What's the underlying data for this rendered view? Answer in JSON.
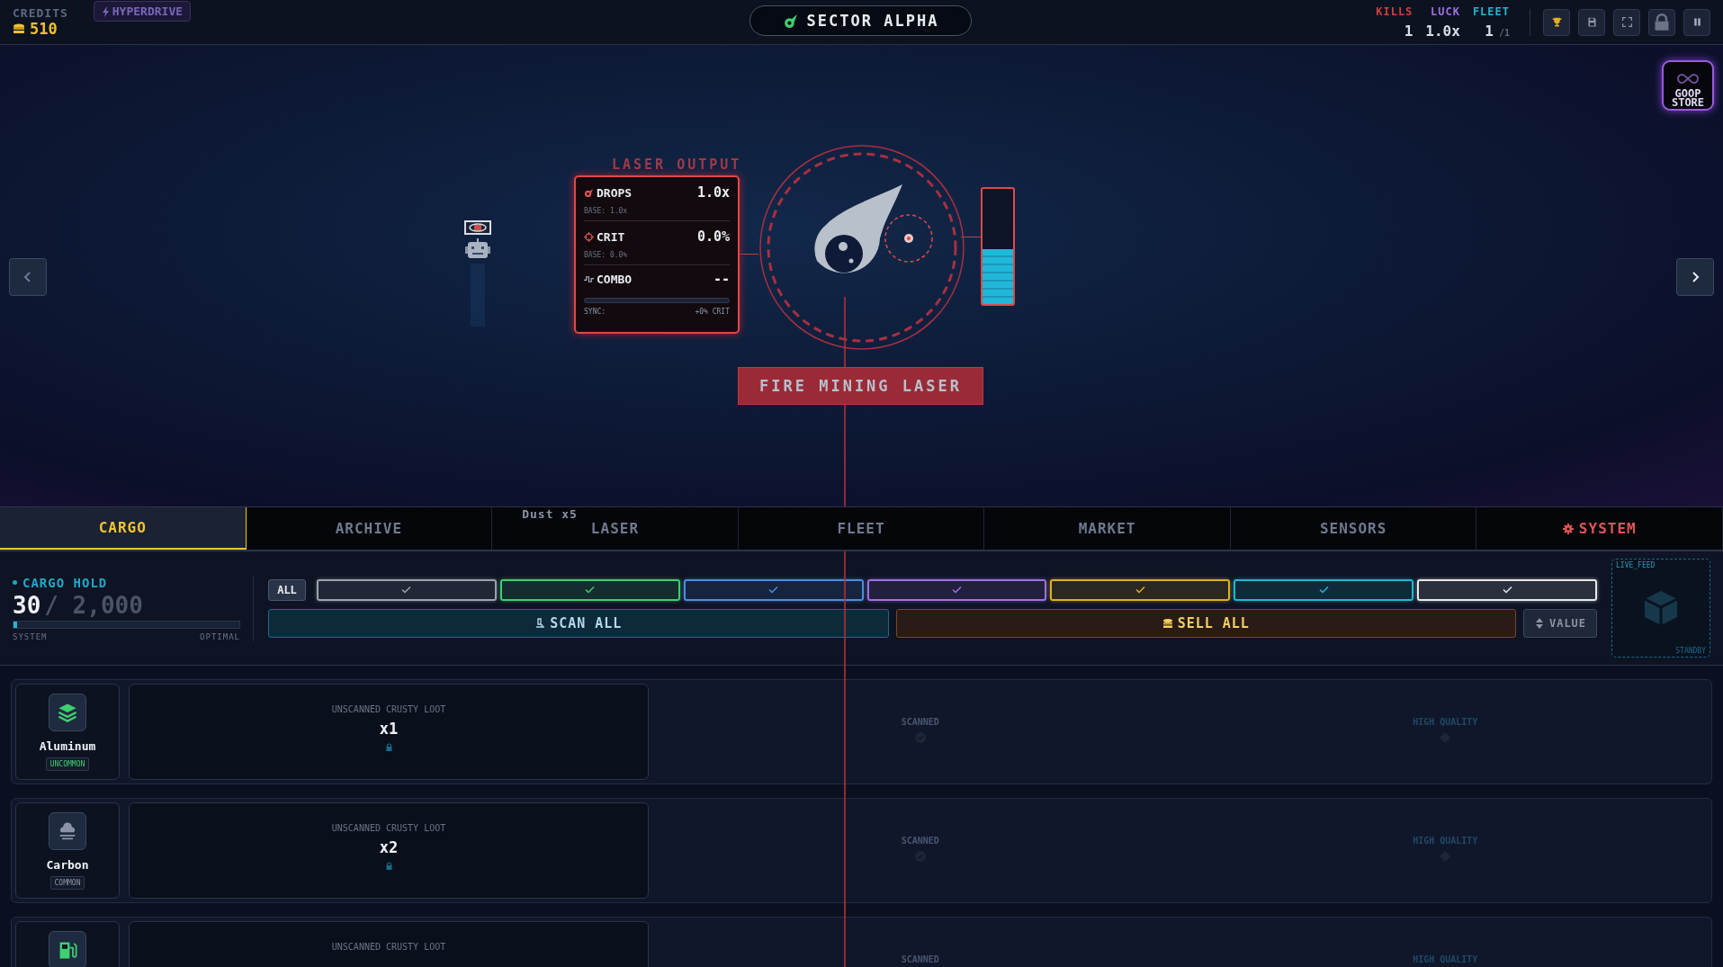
{
  "top_bar": {
    "credits_label": "CREDITS",
    "credits": "510",
    "hyperdrive": "HYPERDRIVE",
    "sector": "SECTOR ALPHA",
    "stats": [
      {
        "label": "KILLS",
        "value": "1",
        "color": "#d04040"
      },
      {
        "label": "LUCK",
        "value": "1.0x",
        "color": "#a070e0"
      },
      {
        "label": "FLEET",
        "value": "1",
        "max": "/1",
        "color": "#20b8d0"
      }
    ],
    "tools": [
      {
        "kind": "trophy"
      },
      {
        "kind": "save"
      },
      {
        "kind": "fullscreen"
      },
      {
        "kind": "lock"
      },
      {
        "kind": "pause"
      }
    ]
  },
  "goop_store": {
    "label": "GOOP STORE"
  },
  "laser_output": {
    "title": "LASER OUTPUT",
    "stats": [
      {
        "kind": "drops",
        "label": "DROPS",
        "value": "1.0x",
        "base": "BASE: 1.0x"
      },
      {
        "kind": "crit",
        "label": "CRIT",
        "value": "0.0%",
        "base": "BASE: 0.0%"
      }
    ],
    "combo": {
      "label": "COMBO",
      "value": "--",
      "sync_label": "SYNC:",
      "sync_value": "+0% CRIT"
    }
  },
  "charge": {
    "level": 0.48
  },
  "fire_button": "FIRE MINING LASER",
  "tabs": [
    {
      "label": "CARGO",
      "selected": true,
      "kind": "normal"
    },
    {
      "label": "ARCHIVE",
      "selected": false,
      "kind": "normal"
    },
    {
      "label": "LASER",
      "selected": false,
      "kind": "normal",
      "badge": "Dust x5"
    },
    {
      "label": "FLEET",
      "selected": false,
      "kind": "normal"
    },
    {
      "label": "MARKET",
      "selected": false,
      "kind": "normal"
    },
    {
      "label": "SENSORS",
      "selected": false,
      "kind": "normal"
    },
    {
      "label": "SYSTEM",
      "selected": false,
      "kind": "system"
    }
  ],
  "cargo_hold": {
    "title": "CARGO HOLD",
    "count": "30",
    "capacity": "/ 2,000",
    "level": 0.015,
    "left_label": "SYSTEM",
    "right_label": "OPTIMAL"
  },
  "filters": {
    "all": "ALL",
    "chips": [
      {
        "color": "#9aa3b0",
        "checked": true
      },
      {
        "color": "#3fcf6f",
        "checked": true
      },
      {
        "color": "#4a8fe0",
        "checked": true
      },
      {
        "color": "#a070e0",
        "checked": true
      },
      {
        "color": "#e0b020",
        "checked": true
      },
      {
        "color": "#20b8d0",
        "checked": true
      },
      {
        "color": "#e8e8e8",
        "checked": true
      }
    ]
  },
  "actions": {
    "scan": "SCAN ALL",
    "sell": "SELL ALL",
    "sort": "VALUE"
  },
  "live_feed": {
    "title": "LIVE_FEED",
    "status": "STANDBY"
  },
  "items": [
    {
      "kind": "layers",
      "name": "Aluminum",
      "rarity": "UNCOMMON",
      "color": "#3fcf6f",
      "loot_label": "UNSCANNED CRUSTY LOOT",
      "count": "x1",
      "scanned_label": "SCANNED",
      "quality_label": "HIGH QUALITY"
    },
    {
      "kind": "cloud",
      "name": "Carbon",
      "rarity": "COMMON",
      "color": "#8a94a6",
      "loot_label": "UNSCANNED CRUSTY LOOT",
      "count": "x2",
      "scanned_label": "SCANNED",
      "quality_label": "HIGH QUALITY"
    },
    {
      "kind": "fuel",
      "loot_label": "UNSCANNED CRUSTY LOOT",
      "scanned_label": "SCANNED",
      "quality_label": "HIGH QUALITY"
    }
  ]
}
